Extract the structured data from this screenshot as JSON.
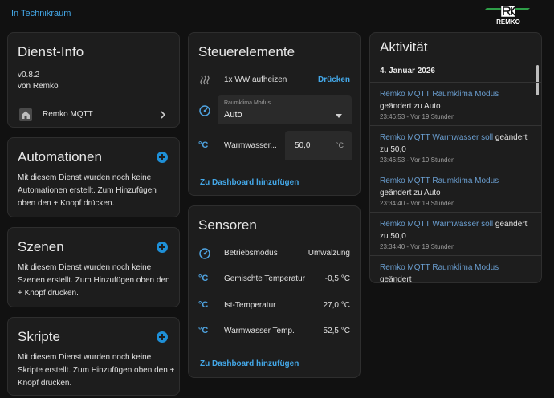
{
  "breadcrumb": "In Technikraum",
  "logo_text": "REMKO",
  "colors": {
    "accent": "#44a8e8",
    "add_button": "#1e8fd6",
    "entity_link": "#6a9ed0"
  },
  "dienst": {
    "title": "Dienst-Info",
    "version": "v0.8.2",
    "by": "von Remko",
    "integration": "Remko MQTT"
  },
  "automationen": {
    "title": "Automationen",
    "text": "Mit diesem Dienst wurden noch keine Automationen erstellt. Zum Hinzufügen oben den + Knopf drücken."
  },
  "szenen": {
    "title": "Szenen",
    "text": "Mit diesem Dienst wurden noch keine Szenen erstellt. Zum Hinzufügen oben den + Knopf drücken."
  },
  "skripte": {
    "title": "Skripte",
    "text": "Mit diesem Dienst wurden noch keine Skripte erstellt. Zum Hinzufügen oben den + Knopf drücken."
  },
  "steuer": {
    "title": "Steuerelemente",
    "ww_label": "1x WW aufheizen",
    "ww_action": "Drücken",
    "select_label": "Raumklima Modus",
    "select_value": "Auto",
    "ws_label": "Warmwasser...",
    "ws_value": "50,0",
    "ws_unit": "°C",
    "dashboard": "Zu Dashboard hinzufügen"
  },
  "sensoren": {
    "title": "Sensoren",
    "rows": [
      {
        "label": "Betriebsmodus",
        "value": "Umwälzung"
      },
      {
        "label": "Gemischte Temperatur",
        "value": "-0,5 °C"
      },
      {
        "label": "Ist-Temperatur",
        "value": "27,0 °C"
      },
      {
        "label": "Warmwasser Temp.",
        "value": "52,5 °C"
      }
    ],
    "dashboard": "Zu Dashboard hinzufügen"
  },
  "aktivitaet": {
    "title": "Aktivität",
    "date": "4. Januar 2026",
    "entries": [
      {
        "entity": "Remko MQTT Raumklima Modus",
        "action": "geändert zu Auto",
        "time": "23:46:53 - Vor 19 Stunden"
      },
      {
        "entity": "Remko MQTT Warmwasser soll",
        "action": "geändert zu 50,0",
        "time": "23:46:53 - Vor 19 Stunden"
      },
      {
        "entity": "Remko MQTT Raumklima Modus",
        "action": "geändert zu Auto",
        "time": "23:34:40 - Vor 19 Stunden"
      },
      {
        "entity": "Remko MQTT Warmwasser soll",
        "action": "geändert zu 50,0",
        "time": "23:34:40 - Vor 19 Stunden"
      },
      {
        "entity": "Remko MQTT Raumklima Modus",
        "action": "geändert",
        "time": ""
      }
    ]
  }
}
